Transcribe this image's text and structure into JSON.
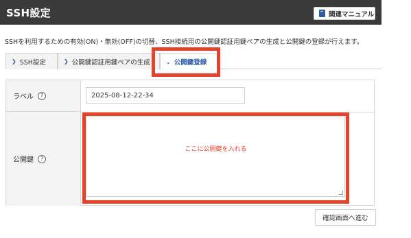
{
  "header": {
    "title": "SSH設定",
    "manual_button": "関連マニュアル"
  },
  "description": "SSHを利用するための有効(ON)・無効(OFF)の切替、SSH接続用の公開鍵認証用鍵ペアの生成と公開鍵の登録が行えます。",
  "tabs": [
    {
      "label": "SSH設定",
      "active": false
    },
    {
      "label": "公開鍵認証用鍵ペアの生成",
      "active": false
    },
    {
      "label": "公開鍵登録",
      "active": true
    }
  ],
  "form": {
    "label_field": {
      "label": "ラベル",
      "help": "?",
      "value": "2025-08-12-22-34"
    },
    "public_key_field": {
      "label": "公開鍵",
      "help": "?",
      "annotation": "ここに公開鍵を入れる"
    }
  },
  "confirm_button": "確認画面へ進む",
  "colors": {
    "header_bg": "#3a3a3a",
    "highlight": "#e8412b",
    "active_tab": "#2a5da8"
  },
  "icons": {
    "manual": "book-icon",
    "help": "help-circle-icon",
    "tab": "chevron-icon"
  }
}
